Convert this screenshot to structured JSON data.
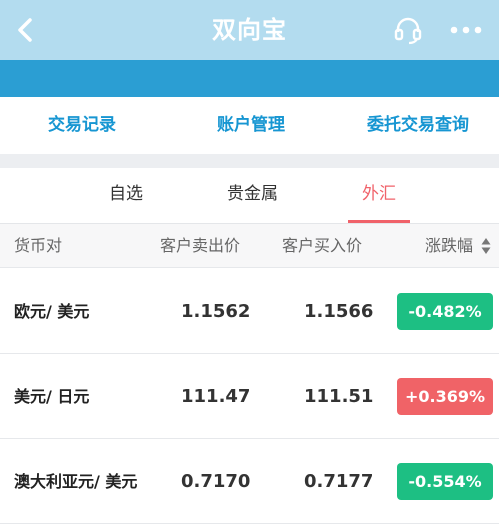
{
  "header": {
    "title": "双向宝",
    "back_icon": "chevron-left-icon",
    "service_icon": "headset-icon",
    "more_icon": "more-dots-icon"
  },
  "quick_actions": [
    "交易记录",
    "账户管理",
    "委托交易查询"
  ],
  "tabs": [
    {
      "label": "自选",
      "active": false
    },
    {
      "label": "贵金属",
      "active": false
    },
    {
      "label": "外汇",
      "active": true
    }
  ],
  "table": {
    "headers": [
      "货币对",
      "客户卖出价",
      "客户买入价",
      "涨跌幅"
    ],
    "rows": [
      {
        "pair": "欧元/ 美元",
        "sell": "1.1562",
        "buy": "1.1566",
        "change": "-0.482%",
        "direction": "down"
      },
      {
        "pair": "美元/ 日元",
        "sell": "111.47",
        "buy": "111.51",
        "change": "+0.369%",
        "direction": "up"
      },
      {
        "pair": "澳大利亚元/ 美元",
        "sell": "0.7170",
        "buy": "0.7177",
        "change": "-0.554%",
        "direction": "down"
      }
    ]
  },
  "colors": {
    "header_bg": "#b3dcef",
    "banner_bg": "#2b9ed3",
    "accent_blue": "#1796d2",
    "active_tab": "#f0626a",
    "down_green": "#1dbf83",
    "up_red": "#f06367"
  }
}
